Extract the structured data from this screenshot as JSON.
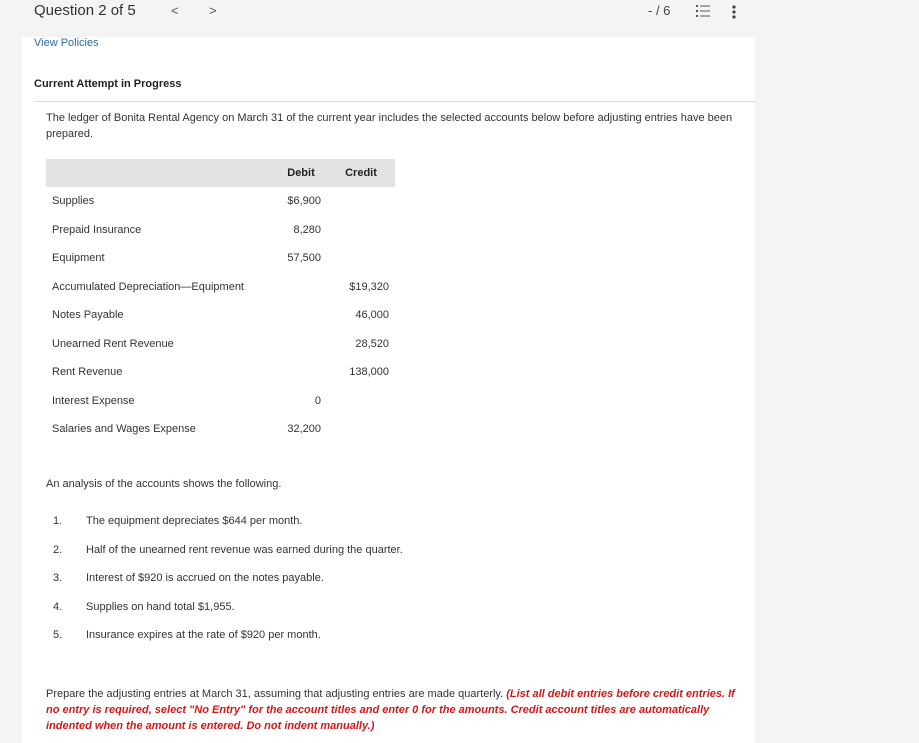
{
  "header": {
    "question_label": "Question 2 of 5",
    "prev_symbol": "<",
    "next_symbol": ">",
    "score": "- / 6"
  },
  "links": {
    "view_policies": "View Policies"
  },
  "attempt": {
    "label": "Current Attempt in Progress"
  },
  "problem": {
    "intro": "The ledger of Bonita Rental Agency on March 31 of the current year includes the selected accounts below before adjusting entries have been prepared.",
    "table": {
      "headers": [
        "",
        "Debit",
        "Credit"
      ],
      "rows": [
        {
          "account": "Supplies",
          "debit": "$6,900",
          "credit": ""
        },
        {
          "account": "Prepaid Insurance",
          "debit": "8,280",
          "credit": ""
        },
        {
          "account": "Equipment",
          "debit": "57,500",
          "credit": ""
        },
        {
          "account": "Accumulated Depreciation—Equipment",
          "debit": "",
          "credit": "$19,320"
        },
        {
          "account": "Notes Payable",
          "debit": "",
          "credit": "46,000"
        },
        {
          "account": "Unearned Rent Revenue",
          "debit": "",
          "credit": "28,520"
        },
        {
          "account": "Rent Revenue",
          "debit": "",
          "credit": "138,000"
        },
        {
          "account": "Interest Expense",
          "debit": "0",
          "credit": ""
        },
        {
          "account": "Salaries and Wages Expense",
          "debit": "32,200",
          "credit": ""
        }
      ]
    },
    "analysis_intro": "An analysis of the accounts shows the following.",
    "analysis": [
      {
        "num": "1.",
        "text": "The equipment depreciates $644 per month."
      },
      {
        "num": "2.",
        "text": "Half of the unearned rent revenue was earned during the quarter."
      },
      {
        "num": "3.",
        "text": "Interest of $920 is accrued on the notes payable."
      },
      {
        "num": "4.",
        "text": "Supplies on hand total $1,955."
      },
      {
        "num": "5.",
        "text": "Insurance expires at the rate of $920 per month."
      }
    ],
    "instructions": {
      "plain": "Prepare the adjusting entries at March 31, assuming that adjusting entries are made quarterly. ",
      "emphasis": "(List all debit entries before credit entries. If no entry is required, select \"No Entry\" for the account titles and enter 0 for the amounts. Credit account titles are automatically indented when the amount is entered. Do not indent manually.)"
    }
  },
  "icons": {
    "question_list": "list-icon",
    "more_options": "more-vertical-icon"
  },
  "colors": {
    "link": "#2b6aa6",
    "emphasis_red": "#d01919",
    "table_header_bg": "#e3e3e3"
  }
}
